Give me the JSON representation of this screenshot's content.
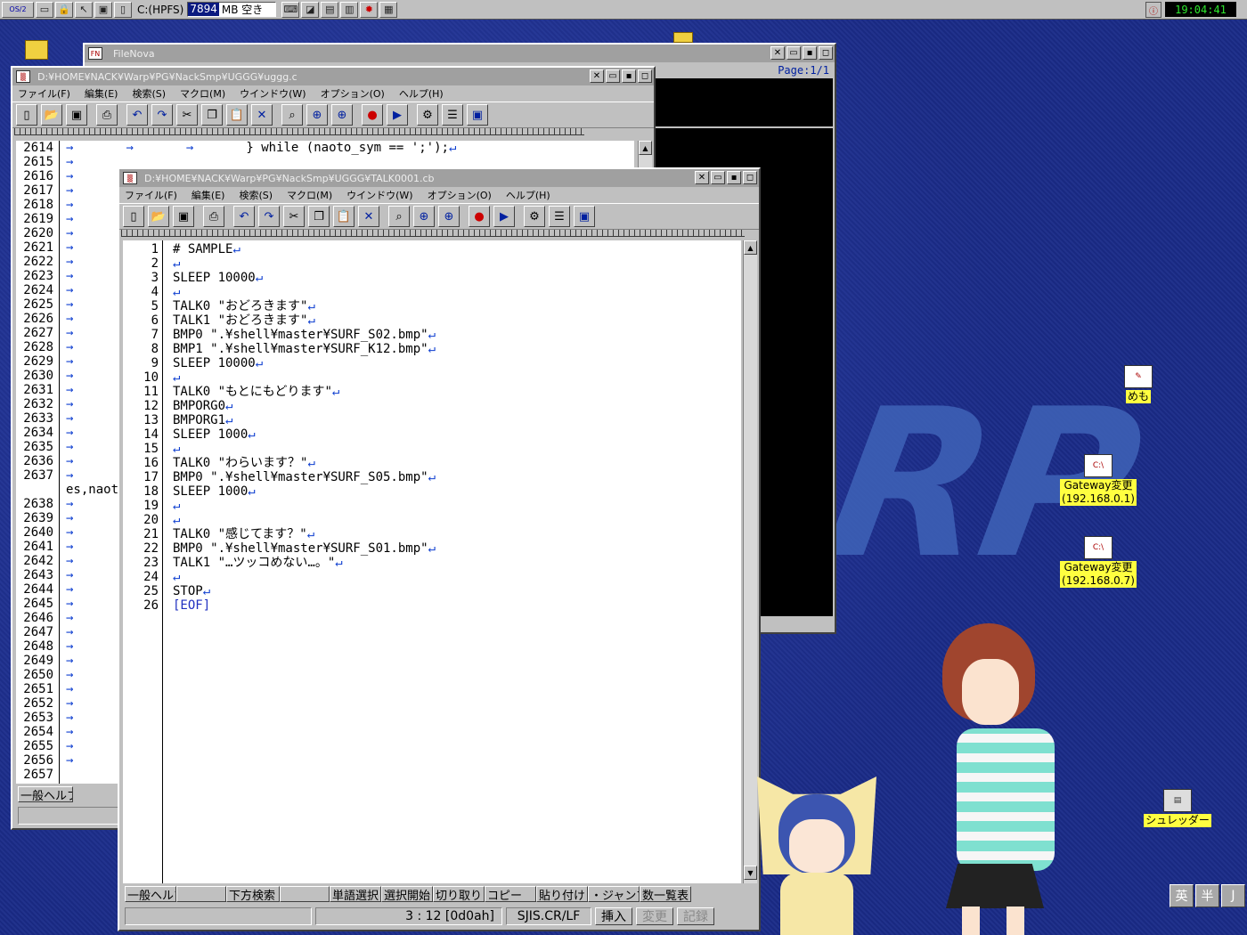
{
  "taskbar": {
    "drive_label": "C:(HPFS)",
    "free_mb": "7894",
    "free_suffix": "MB 空き",
    "clock": "19:04:41"
  },
  "filenova": {
    "title": "FileNova",
    "page": "Page:1/1"
  },
  "win1": {
    "title": "D:¥HOME¥NACK¥Warp¥PG¥NackSmp¥UGGG¥uggg.c",
    "menu": [
      "ファイル(F)",
      "編集(E)",
      "検索(S)",
      "マクロ(M)",
      "ウインドウ(W)",
      "オプション(O)",
      "ヘルプ(H)"
    ],
    "line_numbers": [
      "2614",
      "2615",
      "2616",
      "2617",
      "2618",
      "2619",
      "2620",
      "2621",
      "2622",
      "2623",
      "2624",
      "2625",
      "2626",
      "2627",
      "2628",
      "2629",
      "2630",
      "2631",
      "2632",
      "2633",
      "2634",
      "2635",
      "2636",
      "2637",
      "",
      "2638",
      "2639",
      "2640",
      "2641",
      "2642",
      "2643",
      "2644",
      "2645",
      "2646",
      "2647",
      "2648",
      "2649",
      "2650",
      "2651",
      "2652",
      "2653",
      "2654",
      "2655",
      "2656",
      "2657"
    ],
    "first_line": "} while (naoto_sym == ';');",
    "wrapped_line": "es,naoto",
    "fkey": "一般ヘルプ"
  },
  "win2": {
    "title": "D:¥HOME¥NACK¥Warp¥PG¥NackSmp¥UGGG¥TALK0001.cb",
    "menu": [
      "ファイル(F)",
      "編集(E)",
      "検索(S)",
      "マクロ(M)",
      "ウインドウ(W)",
      "オプション(O)",
      "ヘルプ(H)"
    ],
    "lines": [
      "# SAMPLE",
      "",
      "SLEEP 10000",
      "",
      "TALK0 \"おどろきます\"",
      "TALK1 \"おどろきます\"",
      "BMP0 \".¥shell¥master¥SURF_S02.bmp\"",
      "BMP1 \".¥shell¥master¥SURF_K12.bmp\"",
      "SLEEP 10000",
      "",
      "TALK0 \"もとにもどります\"",
      "BMPORG0",
      "BMPORG1",
      "SLEEP 1000",
      "",
      "TALK0 \"わらいます？\"",
      "BMP0 \".¥shell¥master¥SURF_S05.bmp\"",
      "SLEEP 1000",
      "",
      "",
      "TALK0 \"感じてます？\"",
      "BMP0 \".¥shell¥master¥SURF_S01.bmp\"",
      "TALK1 \"…ツッコめない…。\"",
      "",
      "STOP"
    ],
    "eof": "[EOF]",
    "fkeys": [
      "一般ヘルプ",
      "",
      "下方検索",
      "",
      "単語選択",
      "選択開始",
      "切り取り",
      "コピー",
      "貼り付け",
      "・ジャンプ",
      "数一覧表"
    ],
    "status": {
      "position": "3 : 12 [0d0ah]",
      "encoding": "SJIS.CR/LF",
      "insert": "挿入",
      "change": "変更",
      "record": "記録"
    }
  },
  "desktop_icons": [
    {
      "label": "めも"
    },
    {
      "label": "Gateway変更",
      "sub": "(192.168.0.1)"
    },
    {
      "label": "Gateway変更",
      "sub": "(192.168.0.7)"
    },
    {
      "label": "シュレッダー"
    }
  ],
  "ime": [
    "英",
    "半",
    "J"
  ],
  "colors": {
    "desktop": "#1a2b88",
    "title_inactive": "#a0a0a0",
    "label_bg": "#ffff40",
    "clock_fg": "#2ee82e"
  }
}
